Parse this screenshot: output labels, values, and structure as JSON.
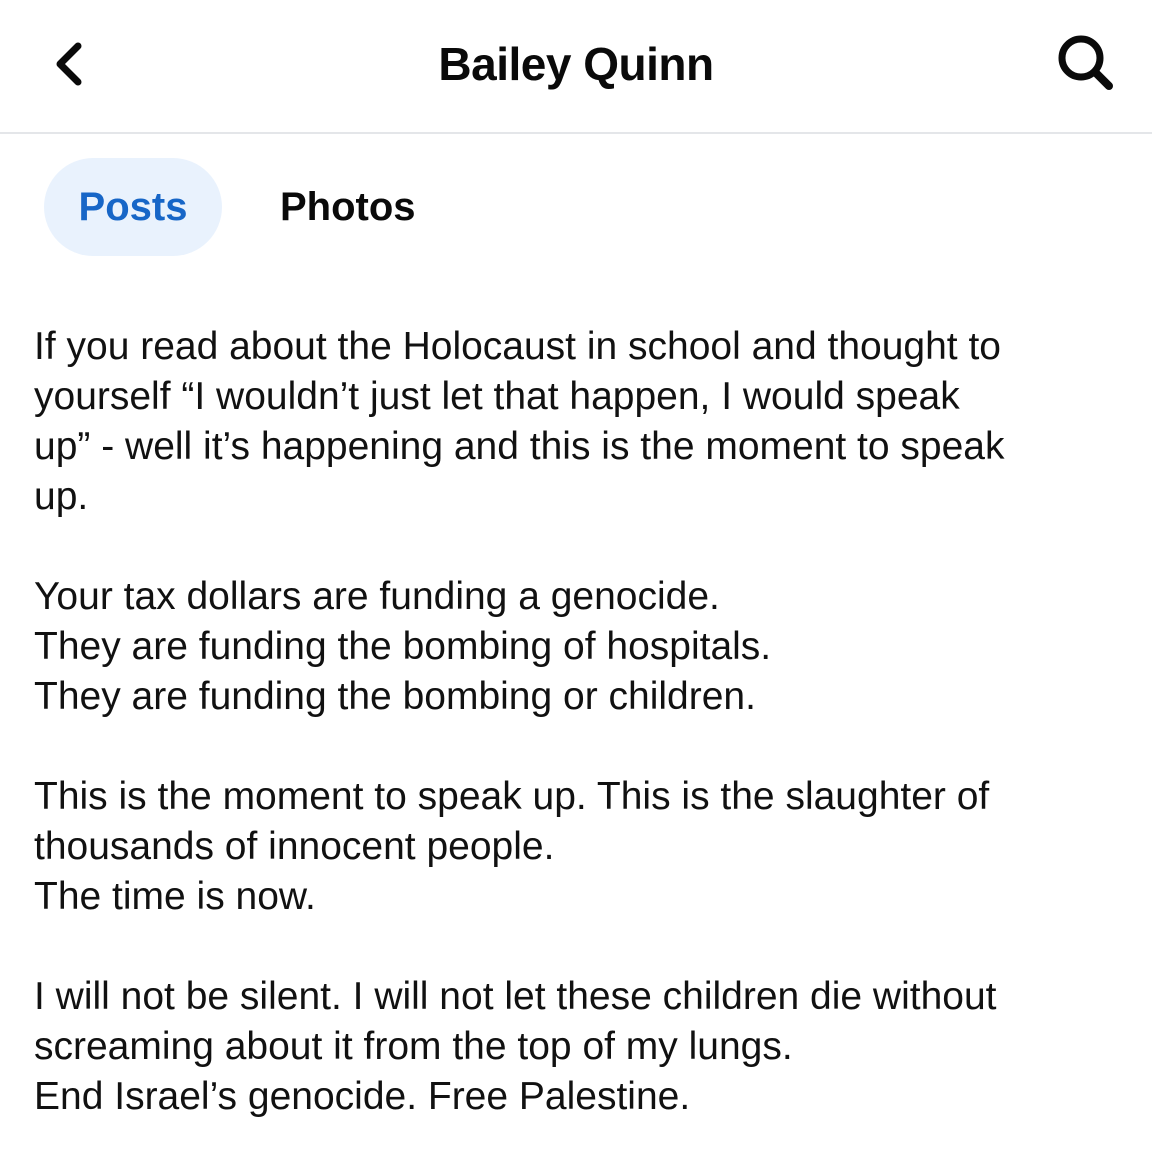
{
  "header": {
    "title": "Bailey Quinn",
    "back_icon": "chevron-left-icon",
    "search_icon": "search-icon"
  },
  "tabs": [
    {
      "label": "Posts",
      "active": true
    },
    {
      "label": "Photos",
      "active": false
    }
  ],
  "colors": {
    "active_tab_text": "#1766c7",
    "active_tab_bg": "#e9f2fd",
    "divider": "#e4e6e9"
  },
  "post": {
    "paragraphs": [
      [
        "If you read about the Holocaust in school and thought to",
        "yourself “I wouldn’t just let that happen, I would speak",
        "up” - well it’s happening and this is the moment to speak",
        "up."
      ],
      [
        "Your tax dollars are funding a genocide.",
        "They are funding the bombing of hospitals.",
        "They are funding the bombing or children."
      ],
      [
        "This is the moment to speak up. This is the slaughter of",
        "thousands of innocent people.",
        "The time is now."
      ],
      [
        "I will not be silent. I will not let these children die without",
        "screaming about it from the top of my lungs.",
        "End Israel’s genocide. Free Palestine."
      ]
    ]
  }
}
